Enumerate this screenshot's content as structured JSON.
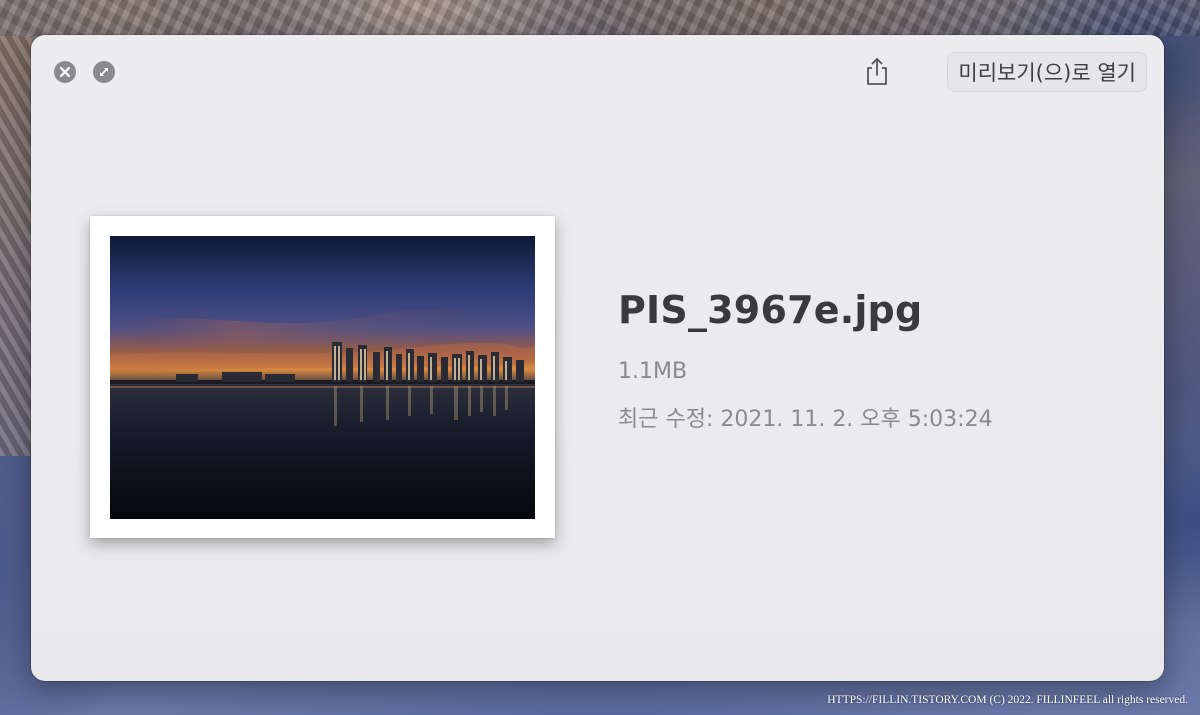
{
  "window": {
    "toolbar": {
      "close_icon": "close-icon",
      "fullscreen_icon": "fullscreen-icon",
      "share_icon": "share-icon",
      "open_with_label": "미리보기(으)로 열기"
    },
    "file": {
      "name": "PIS_3967e.jpg",
      "size": "1.1MB",
      "modified": "최근 수정: 2021. 11. 2. 오후 5:03:24"
    }
  },
  "watermark": "HTTPS://FILLIN.TISTORY.COM (C) 2022. FILLINFEEL all rights reserved.",
  "colors": {
    "window_bg": "#ececee",
    "title_text": "#3a3a3c",
    "meta_text": "#8a8a8e",
    "control_gray": "#8a8a8e"
  }
}
